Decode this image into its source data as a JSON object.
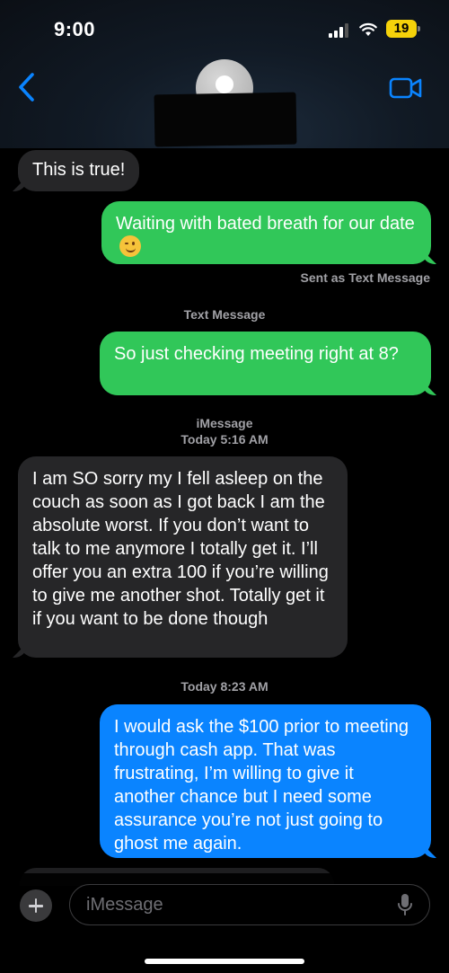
{
  "status_bar": {
    "time": "9:00",
    "battery": "19"
  },
  "header": {
    "back_icon": "chevron-left-icon",
    "video_icon": "video-camera-icon",
    "accent_color": "#0a84ff"
  },
  "messages": [
    {
      "from": "them",
      "text": "This is true!"
    },
    {
      "from": "me",
      "type": "sms",
      "text": "Waiting with bated breath for our date",
      "emoji": "winking-face"
    },
    {
      "note": "Sent as Text Message"
    },
    {
      "meta": "Text Message"
    },
    {
      "from": "me",
      "type": "sms",
      "text": "So just checking meeting right at 8?"
    },
    {
      "meta_lines": [
        "iMessage",
        "Today 5:16 AM"
      ]
    },
    {
      "from": "them",
      "text": "I am SO sorry my I fell asleep on the couch as soon as I got back I am the absolute worst. If you don’t want to talk to me anymore I totally get it. I’ll offer you an extra 100 if you’re willing to give me another shot. Totally get it if you want to be done though"
    },
    {
      "meta": "Today 8:23 AM"
    },
    {
      "from": "me",
      "type": "imessage",
      "text": "I would ask the $100 prior to meeting through cash app. That was frustrating, I’m willing to give it another chance but I need some assurance you’re not just going to ghost me again."
    }
  ],
  "compose": {
    "placeholder": "iMessage",
    "value": ""
  },
  "colors": {
    "sms_bubble": "#31c759",
    "imessage_bubble": "#0a84ff",
    "incoming_bubble": "#262628"
  }
}
